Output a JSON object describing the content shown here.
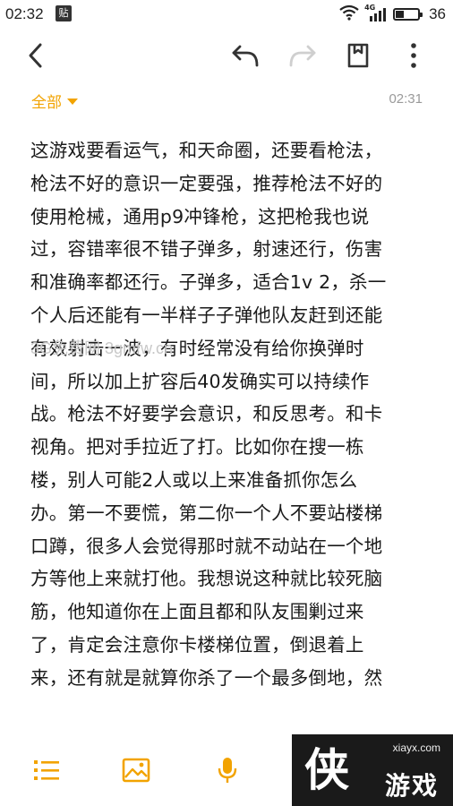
{
  "status_bar": {
    "time": "02:32",
    "badge": "贴",
    "network_label": "4G",
    "battery_level": 0.36,
    "battery_pct": "36"
  },
  "toolbar": {
    "back": "back-arrow-icon",
    "undo": "undo-icon",
    "redo": "redo-icon",
    "bookmark": "bookmark-icon",
    "more": "more-vertical-icon"
  },
  "meta": {
    "folder": "全部",
    "time": "02:31"
  },
  "note": {
    "lines": [
      "这游戏要看运气，和天命圈，还要看枪法，",
      "枪法不好的意识一定要强，推荐枪法不好的",
      "使用枪械，通用p9冲锋枪，这把枪我也说",
      "过，容错率很不错子弹多，射速还行，伤害",
      "和准确率都还行。子弹多，适合1v 2，杀一",
      "个人后还能有一半样子子弹他队友赶到还能",
      "有效射击一波，有时经常没有给你换弹时",
      "间，所以加上扩容后40发确实可以持续作",
      "战。枪法不好要学会意识，和反思考。和卡",
      "视角。把对手拉近了打。比如你在搜一栋",
      "楼，别人可能2人或以上来准备抓你怎么",
      "办。第一不要慌，第二你一个人不要站楼梯",
      "口蹲，很多人会觉得那时就不动站在一个地",
      "方等他上来就打他。我想说这种就比较死脑",
      "筋，他知道你在上面且都和队友围剿过来",
      "了，肯定会注意你卡楼梯位置，倒退着上",
      "来，还有就是就算你杀了一个最多倒地，然"
    ]
  },
  "watermark": "3G免费网 3gmfw.cn",
  "bottom_bar": {
    "list": "list-icon",
    "image": "image-icon",
    "mic": "microphone-icon"
  },
  "site_logo": {
    "url": "xiayx.com",
    "glyph": "侠",
    "name": "游戏"
  },
  "colors": {
    "accent": "#f2a300",
    "text": "#1a1a1a",
    "muted": "#9a9a9a",
    "icon": "#333333",
    "icon_disabled": "#cfcfcf"
  }
}
